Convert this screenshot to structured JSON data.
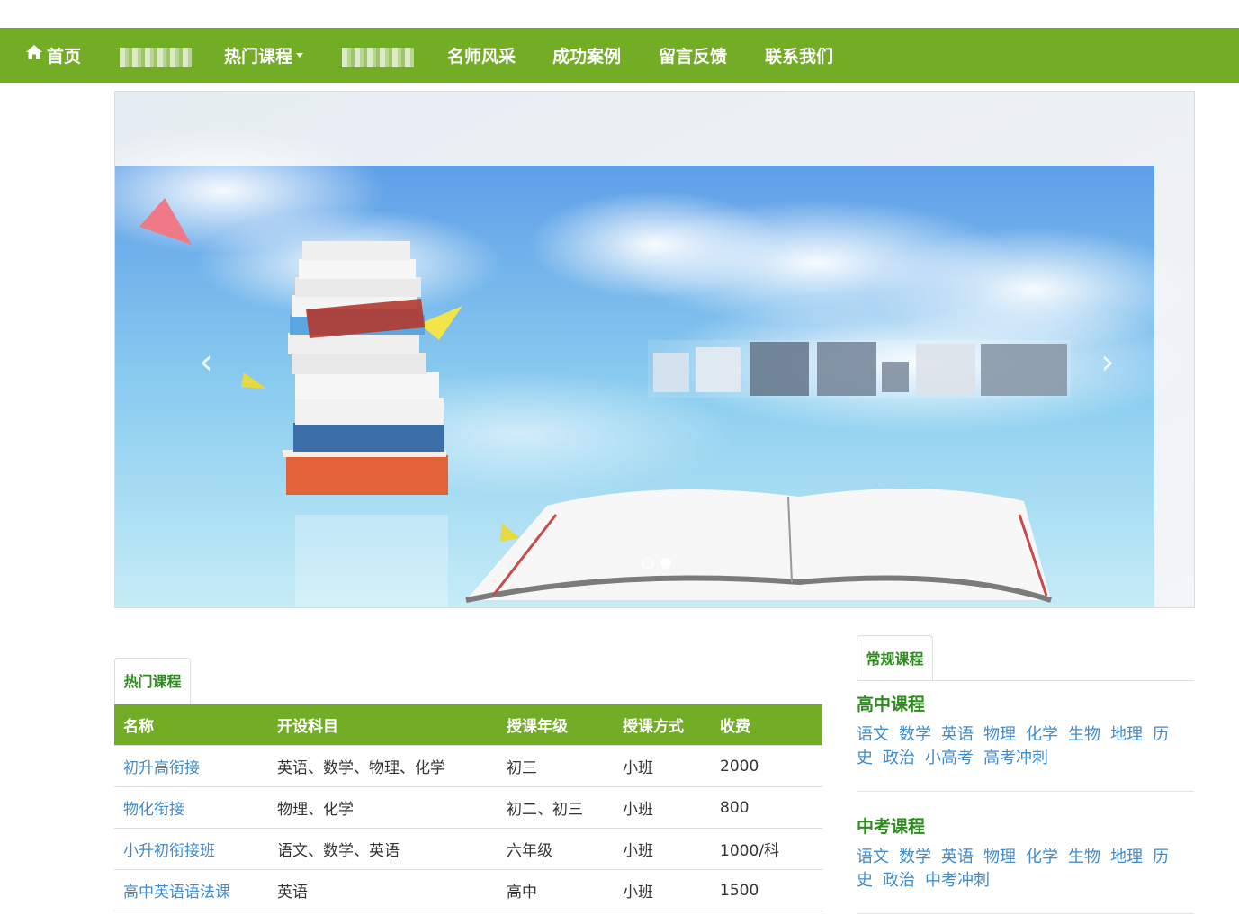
{
  "nav": {
    "home": "首页",
    "hot_courses": "热门课程",
    "teachers": "名师风采",
    "cases": "成功案例",
    "feedback": "留言反馈",
    "contact": "联系我们"
  },
  "carousel": {
    "prev": "‹",
    "next": "›",
    "slides": 2,
    "active_slide": 2
  },
  "hot": {
    "tab": "热门课程",
    "columns": [
      "名称",
      "开设科目",
      "授课年级",
      "授课方式",
      "收费"
    ],
    "rows": [
      [
        "初升高衔接",
        "英语、数学、物理、化学",
        "初三",
        "小班",
        "2000"
      ],
      [
        "物化衔接",
        "物理、化学",
        "初二、初三",
        "小班",
        "800"
      ],
      [
        "小升初衔接班",
        "语文、数学、英语",
        "六年级",
        "小班",
        "1000/科"
      ],
      [
        "高中英语语法课",
        "英语",
        "高中",
        "小班",
        "1500"
      ]
    ]
  },
  "regular": {
    "tab": "常规课程",
    "high_title": "高中课程",
    "high_links": [
      "语文",
      "数学",
      "英语",
      "物理",
      "化学",
      "生物",
      "地理",
      "历史",
      "政治",
      "小高考",
      "高考冲刺"
    ],
    "mid_title": "中考课程",
    "mid_links": [
      "语文",
      "数学",
      "英语",
      "物理",
      "化学",
      "生物",
      "地理",
      "历史",
      "政治",
      "中考冲刺"
    ]
  },
  "colors": {
    "brand_green": "#72ad25",
    "title_green": "#2e8c1e",
    "link_blue": "#428bca"
  }
}
